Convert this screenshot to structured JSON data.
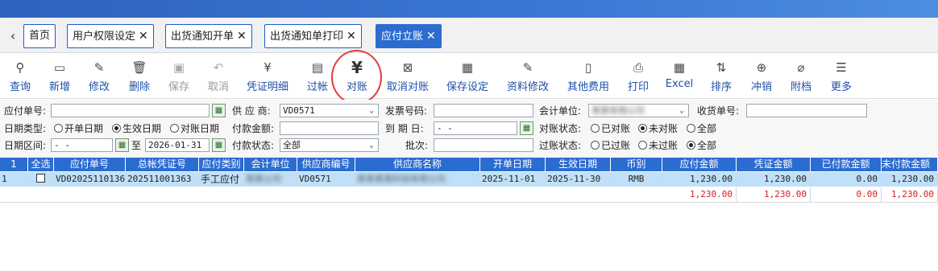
{
  "tabs": [
    {
      "label": "首页",
      "closable": false
    },
    {
      "label": "用户权限设定",
      "closable": true
    },
    {
      "label": "出货通知开单",
      "closable": true
    },
    {
      "label": "出货通知单打印",
      "closable": true
    },
    {
      "label": "应付立账",
      "closable": true,
      "active": true
    }
  ],
  "tab_close_glyph": "✕",
  "tab_back_glyph": "‹",
  "toolbar": [
    {
      "label": "查询",
      "icon": "query-icon",
      "glyph": "⚲"
    },
    {
      "label": "新增",
      "icon": "add-icon",
      "glyph": "▭"
    },
    {
      "label": "修改",
      "icon": "edit-icon",
      "glyph": "✎"
    },
    {
      "label": "删除",
      "icon": "delete-icon",
      "glyph": "🗑"
    },
    {
      "label": "保存",
      "icon": "save-icon",
      "glyph": "▣",
      "disabled": true
    },
    {
      "label": "取消",
      "icon": "undo-icon",
      "glyph": "↶",
      "disabled": true
    },
    {
      "label": "凭证明细",
      "icon": "voucher-icon",
      "glyph": "¥"
    },
    {
      "label": "过帐",
      "icon": "post-icon",
      "glyph": "▤"
    },
    {
      "label": "对账",
      "icon": "yen-icon",
      "glyph": "¥"
    },
    {
      "label": "取消对账",
      "icon": "cancel-reconcile-icon",
      "glyph": "⊠"
    },
    {
      "label": "保存设定",
      "icon": "save-settings-icon",
      "glyph": "▦"
    },
    {
      "label": "资料修改",
      "icon": "data-edit-icon",
      "glyph": "✎"
    },
    {
      "label": "其他费用",
      "icon": "other-fee-icon",
      "glyph": "▯"
    },
    {
      "label": "打印",
      "icon": "print-icon",
      "glyph": "⎙"
    },
    {
      "label": "Excel",
      "icon": "excel-icon",
      "glyph": "▦"
    },
    {
      "label": "排序",
      "icon": "sort-icon",
      "glyph": "⇅"
    },
    {
      "label": "冲销",
      "icon": "offset-icon",
      "glyph": "⊕"
    },
    {
      "label": "附档",
      "icon": "attachment-icon",
      "glyph": "⌀"
    },
    {
      "label": "更多",
      "icon": "more-icon",
      "glyph": "☰"
    }
  ],
  "form": {
    "payable_no_label": "应付单号:",
    "payable_no_value": "",
    "supplier_label": "供 应 商:",
    "supplier_value": "VD0571",
    "invoice_no_label": "发票号码:",
    "invoice_no_value": "",
    "accounting_unit_label": "会计单位:",
    "accounting_unit_value": "某某有限公司",
    "receipt_no_label": "收货单号:",
    "receipt_no_value": "",
    "date_type_label": "日期类型:",
    "date_type_options": [
      "开单日期",
      "生效日期",
      "对账日期"
    ],
    "date_type_selected": 1,
    "payment_amount_label": "付款金额:",
    "payment_amount_value": "",
    "due_date_label": "到 期 日:",
    "due_date_value": "    -  -",
    "reconcile_status_label": "对账状态:",
    "reconcile_options": [
      "已对账",
      "未对账",
      "全部"
    ],
    "reconcile_selected": 1,
    "date_range_label": "日期区间:",
    "date_from_value": "    -  -",
    "to_label": "至",
    "date_to_value": "2026-01-31",
    "payment_status_label": "付款状态:",
    "payment_status_value": "全部",
    "batch_label": "批次:",
    "batch_value": "",
    "posting_status_label": "过账状态:",
    "posting_options": [
      "已过账",
      "未过账",
      "全部"
    ],
    "posting_selected": 2
  },
  "grid": {
    "columns": [
      "1",
      "全选",
      "应付单号",
      "总帐凭证号",
      "应付类别",
      "会计单位",
      "供应商编号",
      "供应商名称",
      "开单日期",
      "生效日期",
      "币别",
      "应付金额",
      "凭证金额",
      "已付款金额",
      "未付款金额"
    ],
    "rows": [
      [
        "1",
        "",
        "VD02025110136",
        "202511001363",
        "手工应付",
        "某某公司",
        "VD0571",
        "某某某某科技有限公司",
        "2025-11-01",
        "2025-11-30",
        "RMB",
        "1,230.00",
        "1,230.00",
        "0.00",
        "1,230.00"
      ]
    ],
    "totals": {
      "payable": "1,230.00",
      "voucher": "1,230.00",
      "paid": "0.00",
      "unpaid": "1,230.00"
    }
  }
}
